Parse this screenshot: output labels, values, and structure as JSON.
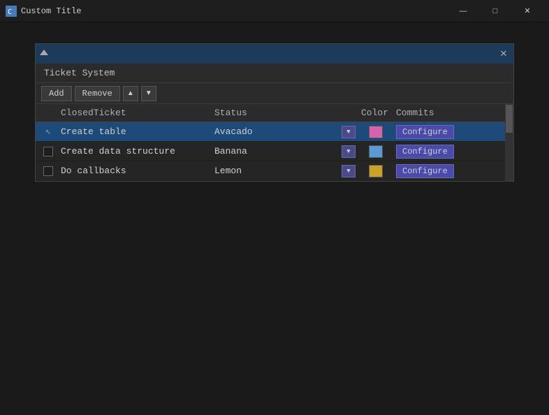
{
  "os_window": {
    "title": "Custom Title",
    "icon_text": "C",
    "controls": {
      "minimize": "—",
      "maximize": "□",
      "close": "✕"
    }
  },
  "dialog": {
    "title_icon": "▼",
    "close_btn": "✕",
    "panel_title": "Ticket System",
    "toolbar": {
      "add_label": "Add",
      "remove_label": "Remove",
      "up_arrow": "▲",
      "down_arrow": "▼"
    },
    "table": {
      "headers": {
        "checkbox": "",
        "ticket": "ClosedTicket",
        "status": "Status",
        "color": "Color",
        "commits": "Commits"
      },
      "rows": [
        {
          "id": 1,
          "checked": true,
          "cursor": true,
          "ticket": "Create table",
          "status": "Avacado",
          "color": "#d463b0",
          "configure": "Configure",
          "selected": true
        },
        {
          "id": 2,
          "checked": false,
          "cursor": false,
          "ticket": "Create data structure",
          "status": "Banana",
          "color": "#5b9bd5",
          "configure": "Configure",
          "selected": false
        },
        {
          "id": 3,
          "checked": false,
          "cursor": false,
          "ticket": "Do callbacks",
          "status": "Lemon",
          "color": "#c9a227",
          "configure": "Configure",
          "selected": false
        }
      ]
    }
  }
}
